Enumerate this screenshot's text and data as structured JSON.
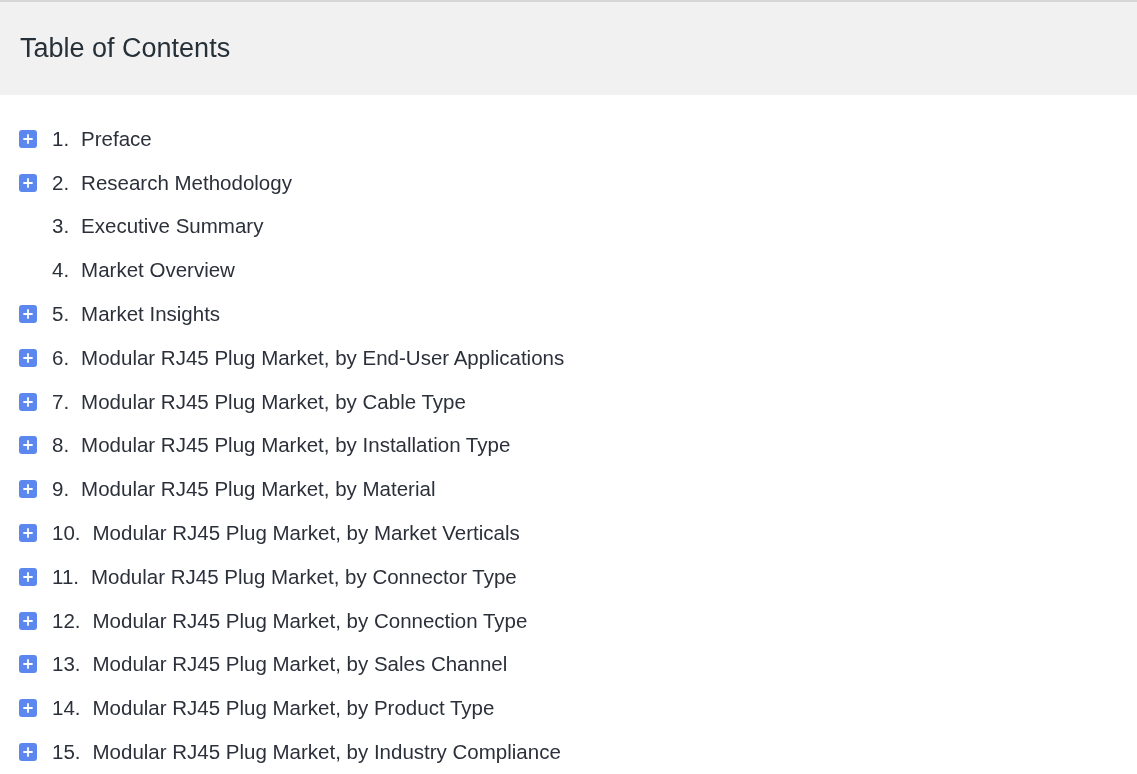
{
  "title": "Table of Contents",
  "items": [
    {
      "number": "1.",
      "label": "Preface",
      "expandable": true
    },
    {
      "number": "2.",
      "label": "Research Methodology",
      "expandable": true
    },
    {
      "number": "3.",
      "label": "Executive Summary",
      "expandable": false
    },
    {
      "number": "4.",
      "label": "Market Overview",
      "expandable": false
    },
    {
      "number": "5.",
      "label": "Market Insights",
      "expandable": true
    },
    {
      "number": "6.",
      "label": "Modular RJ45 Plug Market, by End-User Applications",
      "expandable": true
    },
    {
      "number": "7.",
      "label": "Modular RJ45 Plug Market, by Cable Type",
      "expandable": true
    },
    {
      "number": "8.",
      "label": "Modular RJ45 Plug Market, by Installation Type",
      "expandable": true
    },
    {
      "number": "9.",
      "label": "Modular RJ45 Plug Market, by Material",
      "expandable": true
    },
    {
      "number": "10.",
      "label": "Modular RJ45 Plug Market, by Market Verticals",
      "expandable": true
    },
    {
      "number": "11.",
      "label": "Modular RJ45 Plug Market, by Connector Type",
      "expandable": true
    },
    {
      "number": "12.",
      "label": "Modular RJ45 Plug Market, by Connection Type",
      "expandable": true
    },
    {
      "number": "13.",
      "label": "Modular RJ45 Plug Market, by Sales Channel",
      "expandable": true
    },
    {
      "number": "14.",
      "label": "Modular RJ45 Plug Market, by Product Type",
      "expandable": true
    },
    {
      "number": "15.",
      "label": "Modular RJ45 Plug Market, by Industry Compliance",
      "expandable": true
    }
  ]
}
